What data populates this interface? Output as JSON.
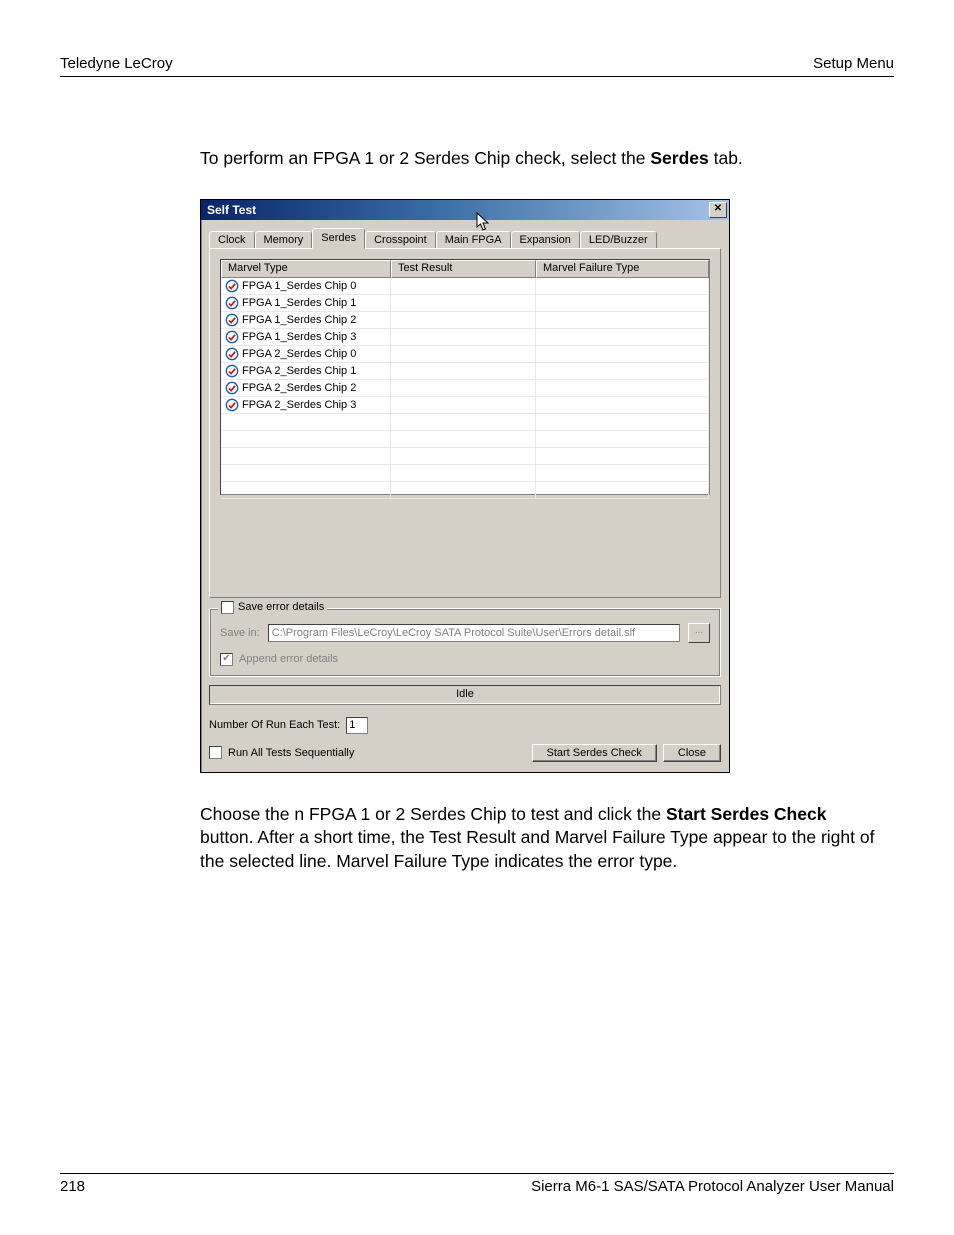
{
  "header": {
    "left": "Teledyne LeCroy",
    "right": "Setup Menu"
  },
  "intro": {
    "pre": "To perform an FPGA 1 or 2 Serdes Chip check, select the ",
    "bold": "Serdes",
    "post": " tab."
  },
  "dialog": {
    "title": "Self Test",
    "tabs": [
      "Clock",
      "Memory",
      "Serdes",
      "Crosspoint",
      "Main FPGA",
      "Expansion",
      "LED/Buzzer"
    ],
    "active_tab_index": 2,
    "columns": [
      "Marvel Type",
      "Test Result",
      "Marvel Failure Type"
    ],
    "rows": [
      {
        "name": "FPGA 1_Serdes Chip 0",
        "result": "",
        "failure": ""
      },
      {
        "name": "FPGA 1_Serdes Chip 1",
        "result": "",
        "failure": ""
      },
      {
        "name": "FPGA 1_Serdes Chip 2",
        "result": "",
        "failure": ""
      },
      {
        "name": "FPGA 1_Serdes Chip 3",
        "result": "",
        "failure": ""
      },
      {
        "name": "FPGA 2_Serdes Chip 0",
        "result": "",
        "failure": ""
      },
      {
        "name": "FPGA 2_Serdes Chip 1",
        "result": "",
        "failure": ""
      },
      {
        "name": "FPGA 2_Serdes Chip 2",
        "result": "",
        "failure": ""
      },
      {
        "name": "FPGA 2_Serdes Chip 3",
        "result": "",
        "failure": ""
      }
    ],
    "empty_row_count": 5,
    "save_group": {
      "legend": "Save error details",
      "save_in_label": "Save in:",
      "path": "C:\\Program Files\\LeCroy\\LeCroy SATA Protocol Suite\\User\\Errors detail.slf",
      "browse": "...",
      "append_label": "Append error details"
    },
    "status": "Idle",
    "num_run_label": "Number Of Run Each Test:",
    "num_run_value": "1",
    "run_seq_label": "Run All Tests Sequentially",
    "start_btn": "Start Serdes Check",
    "close_btn": "Close"
  },
  "outro": {
    "pre": "Choose the n FPGA 1 or 2 Serdes Chip to test and click the ",
    "bold": "Start Serdes Check",
    "post": " button. After a short time, the Test Result and Marvel Failure Type appear to the right of the selected line. Marvel Failure Type indicates the error type."
  },
  "footer": {
    "page": "218",
    "title": "Sierra M6-1 SAS/SATA Protocol Analyzer User Manual"
  }
}
